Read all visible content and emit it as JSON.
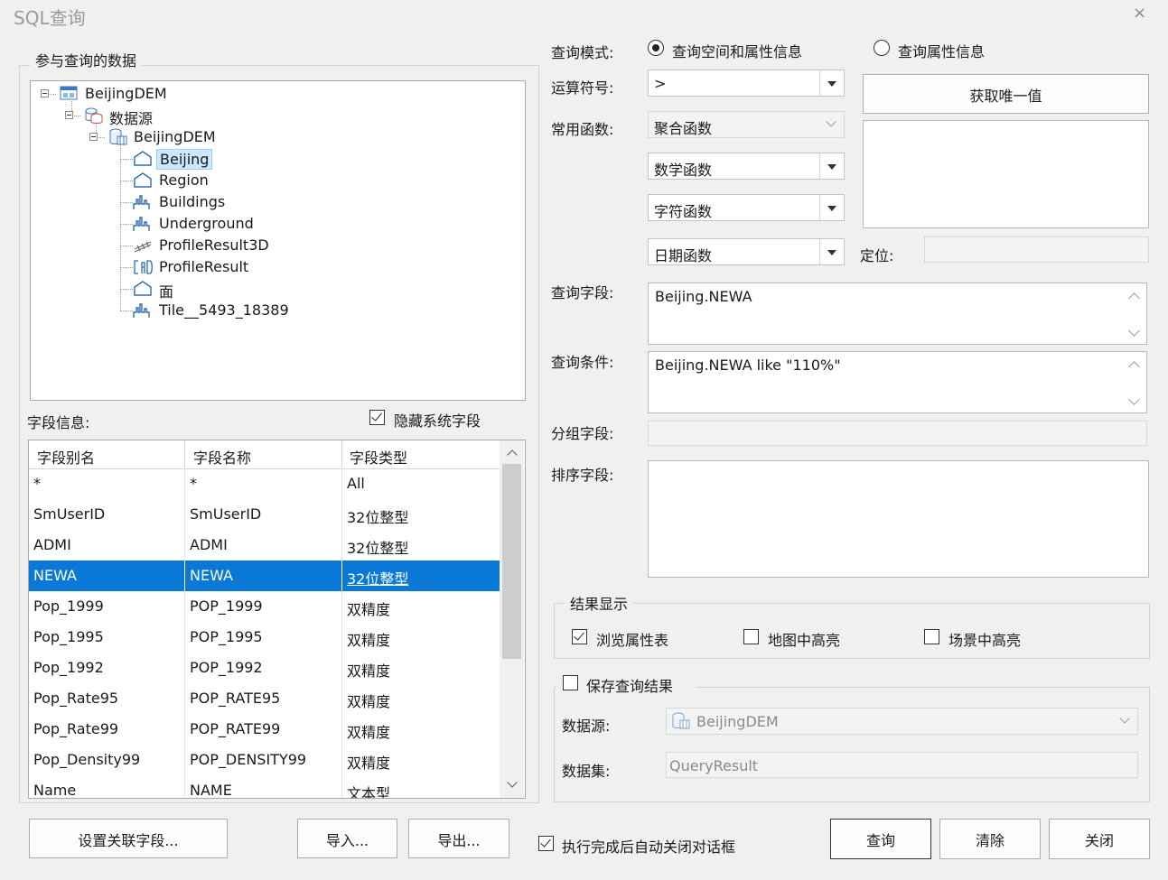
{
  "window": {
    "title": "SQL查询",
    "close_glyph": "×"
  },
  "left": {
    "group_label": "参与查询的数据",
    "tree": [
      {
        "label": "BeijingDEM",
        "icon": "workspace-icon"
      },
      {
        "label": "数据源",
        "icon": "datasources-icon"
      },
      {
        "label": "BeijingDEM",
        "icon": "datasource-icon"
      },
      {
        "label": "Beijing",
        "icon": "region-dataset-icon",
        "selected": true
      },
      {
        "label": "Region",
        "icon": "region-dataset-icon"
      },
      {
        "label": "Buildings",
        "icon": "model-dataset-icon"
      },
      {
        "label": "Underground",
        "icon": "model-dataset-icon"
      },
      {
        "label": "ProfileResult3D",
        "icon": "line3d-dataset-icon"
      },
      {
        "label": "ProfileResult",
        "icon": "cad-dataset-icon"
      },
      {
        "label": "面",
        "icon": "region-dataset-icon"
      },
      {
        "label": "Tile__5493_18389",
        "icon": "model-dataset-icon"
      }
    ],
    "fields_label": "字段信息:",
    "hide_system_fields": {
      "label": "隐藏系统字段",
      "checked": true
    },
    "grid": {
      "headers": [
        "字段别名",
        "字段名称",
        "字段类型"
      ],
      "rows": [
        [
          "*",
          "*",
          "All"
        ],
        [
          "SmUserID",
          "SmUserID",
          "32位整型"
        ],
        [
          "ADMI",
          "ADMI",
          "32位整型"
        ],
        [
          "NEWA",
          "NEWA",
          "32位整型"
        ],
        [
          "Pop_1999",
          "POP_1999",
          "双精度"
        ],
        [
          "Pop_1995",
          "POP_1995",
          "双精度"
        ],
        [
          "Pop_1992",
          "POP_1992",
          "双精度"
        ],
        [
          "Pop_Rate95",
          "POP_RATE95",
          "双精度"
        ],
        [
          "Pop_Rate99",
          "POP_RATE99",
          "双精度"
        ],
        [
          "Pop_Density99",
          "POP_DENSITY99",
          "双精度"
        ],
        [
          "Name",
          "NAME",
          "文本型"
        ]
      ],
      "selected_row": 3,
      "scroll_fraction": 0.0
    }
  },
  "right": {
    "query_mode_label": "查询模式:",
    "mode_spatial": {
      "label": "查询空间和属性信息",
      "checked": true
    },
    "mode_attr": {
      "label": "查询属性信息",
      "checked": false
    },
    "operator_label": "运算符号:",
    "operator_value": ">",
    "functions_label": "常用函数:",
    "aggregate_fn": "聚合函数",
    "math_fn": "数学函数",
    "string_fn": "字符函数",
    "date_fn": "日期函数",
    "unique_button": "获取唯一值",
    "locate_label": "定位:",
    "query_field_label": "查询字段:",
    "query_field_value": "Beijing.NEWA",
    "condition_label": "查询条件:",
    "condition_value": "Beijing.NEWA like \"110%\"",
    "group_field_label": "分组字段:",
    "sort_field_label": "排序字段:",
    "result_group": "结果显示",
    "browse_table": {
      "label": "浏览属性表",
      "checked": true
    },
    "map_highlight": {
      "label": "地图中高亮",
      "checked": false
    },
    "scene_highlight": {
      "label": "场景中高亮",
      "checked": false
    },
    "save_result": {
      "label": "保存查询结果",
      "checked": false
    },
    "datasource_label": "数据源:",
    "datasource_value": "BeijingDEM",
    "dataset_label": "数据集:",
    "dataset_value": "QueryResult"
  },
  "bottom": {
    "relate_button": "设置关联字段...",
    "import_button": "导入...",
    "export_button": "导出...",
    "auto_close": {
      "label": "执行完成后自动关闭对话框",
      "checked": true
    },
    "query_button": "查询",
    "clear_button": "清除",
    "close_button": "关闭"
  },
  "colors": {
    "selection": "#0a78d7",
    "tree_selection": "#cce8ff"
  }
}
